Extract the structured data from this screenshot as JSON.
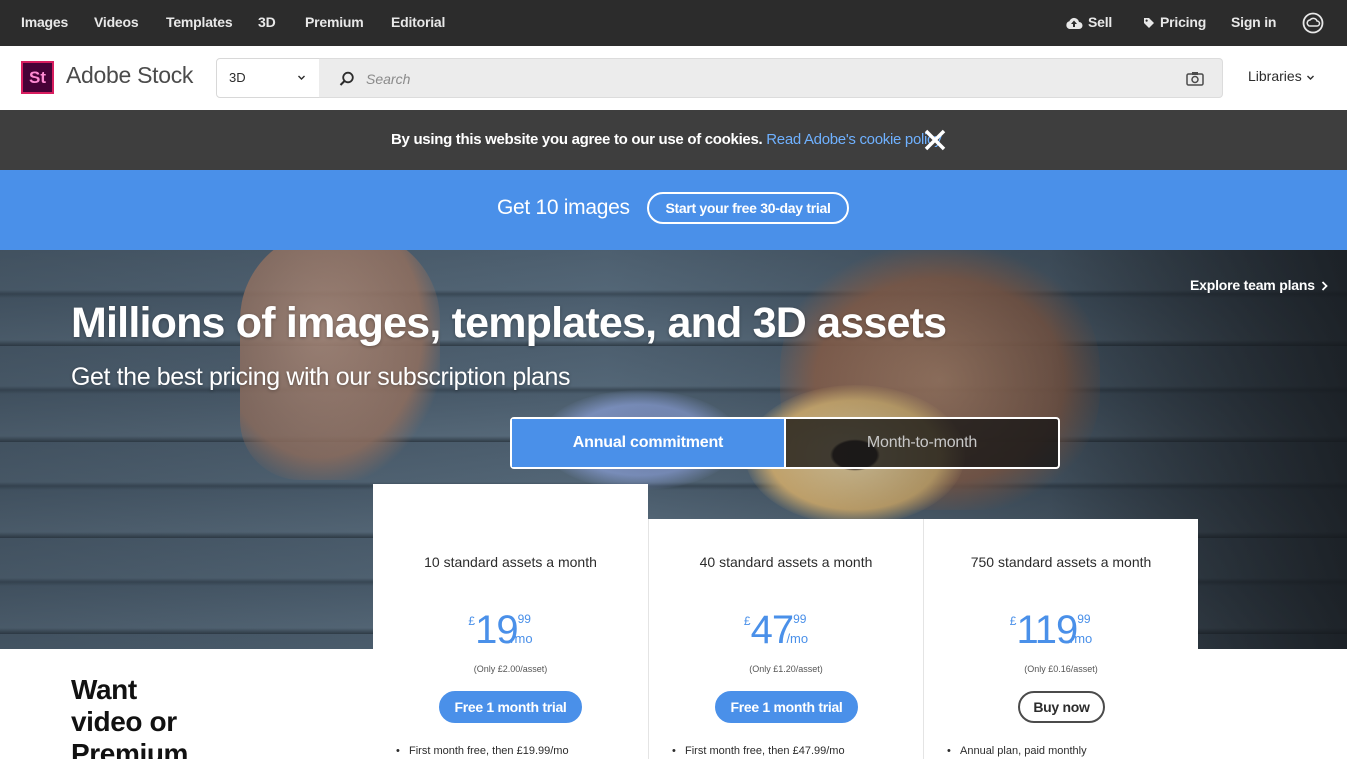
{
  "topnav": {
    "left": [
      "Images",
      "Videos",
      "Templates",
      "3D",
      "Premium",
      "Editorial"
    ],
    "sell": "Sell",
    "pricing": "Pricing",
    "signin": "Sign in"
  },
  "header": {
    "logo_text": "St",
    "brand": "Adobe Stock",
    "search_type": "3D",
    "search_placeholder": "Search",
    "libraries": "Libraries"
  },
  "cookie": {
    "message": "By using this website you agree to our use of cookies.",
    "link": "Read Adobe's cookie policy"
  },
  "promo": {
    "text": "Get 10 images",
    "button": "Start your free 30-day trial"
  },
  "hero": {
    "headline": "Millions of images, templates, and 3D assets",
    "subheadline": "Get the best pricing with our subscription plans",
    "explore": "Explore team plans",
    "toggle": {
      "active": "Annual commitment",
      "inactive": "Month-to-month"
    }
  },
  "side_promo": {
    "line1": "Want",
    "line2": "video or",
    "line3": "Premium"
  },
  "plans": [
    {
      "title": "10 standard assets a month",
      "currency": "£",
      "price_int": "19",
      "price_dec": "99",
      "period": "/mo",
      "per_asset": "(Only £2.00/asset)",
      "cta": "Free 1 month trial",
      "feature": "First month free, then £19.99/mo"
    },
    {
      "title": "40 standard assets a month",
      "currency": "£",
      "price_int": "47",
      "price_dec": "99",
      "period": "/mo",
      "per_asset": "(Only £1.20/asset)",
      "cta": "Free 1 month trial",
      "feature": "First month free, then £47.99/mo"
    },
    {
      "title": "750 standard assets a month",
      "currency": "£",
      "price_int": "119",
      "price_dec": "99",
      "period": "/mo",
      "per_asset": "(Only £0.16/asset)",
      "cta": "Buy now",
      "feature": "Annual plan, paid monthly"
    }
  ],
  "colors": {
    "accent_blue": "#4a90e9",
    "topnav_bg": "#2c2c2c",
    "cookie_bg": "#3e3e3e",
    "cookie_link": "#6fb1ff",
    "logo_bg": "#470137",
    "logo_border": "#d81d5f"
  },
  "icons": {
    "sell": "cloud-upload-icon",
    "pricing": "tag-icon",
    "creative_cloud": "creative-cloud-icon",
    "search_type_chevron": "chevron-down-icon",
    "search": "search-icon",
    "visual_search": "camera-icon",
    "libraries_chevron": "chevron-down-icon",
    "cookie_close": "close-icon",
    "explore_chevron": "chevron-right-icon"
  }
}
